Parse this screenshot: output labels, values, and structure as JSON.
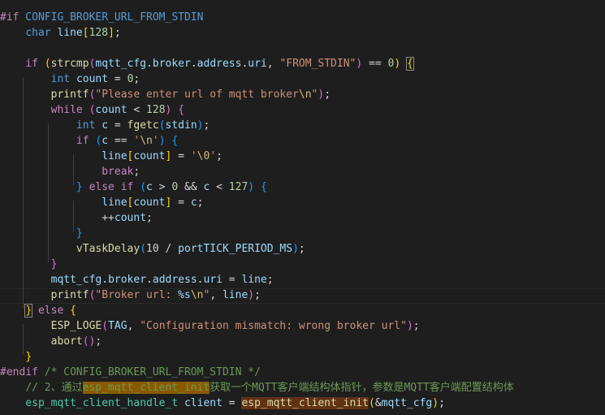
{
  "editor": {
    "lines": [
      {
        "tokens": [
          {
            "t": "#if",
            "c": "pp"
          },
          {
            "t": " CONFIG_BROKER_URL_FROM_STDIN",
            "c": "macro"
          }
        ]
      },
      {
        "tokens": [
          {
            "t": "    "
          },
          {
            "t": "char",
            "c": "kw"
          },
          {
            "t": " "
          },
          {
            "t": "line",
            "c": "var"
          },
          {
            "t": "[",
            "c": "br1"
          },
          {
            "t": "128",
            "c": "num"
          },
          {
            "t": "]",
            "c": "br1"
          },
          {
            "t": ";"
          }
        ]
      },
      {
        "tokens": []
      },
      {
        "tokens": [
          {
            "t": "    "
          },
          {
            "t": "if",
            "c": "ctrl"
          },
          {
            "t": " "
          },
          {
            "t": "(",
            "c": "br1"
          },
          {
            "t": "strcmp",
            "c": "fn"
          },
          {
            "t": "(",
            "c": "br2"
          },
          {
            "t": "mqtt_cfg",
            "c": "var"
          },
          {
            "t": "."
          },
          {
            "t": "broker",
            "c": "var"
          },
          {
            "t": "."
          },
          {
            "t": "address",
            "c": "var"
          },
          {
            "t": "."
          },
          {
            "t": "uri",
            "c": "var"
          },
          {
            "t": ", "
          },
          {
            "t": "\"FROM_STDIN\"",
            "c": "str"
          },
          {
            "t": ")",
            "c": "br2"
          },
          {
            "t": " == "
          },
          {
            "t": "0",
            "c": "num"
          },
          {
            "t": ")",
            "c": "br1"
          },
          {
            "t": " "
          },
          {
            "t": "{",
            "c": "br1 box"
          }
        ]
      },
      {
        "tokens": [
          {
            "t": "        "
          },
          {
            "t": "int",
            "c": "kw"
          },
          {
            "t": " "
          },
          {
            "t": "count",
            "c": "var"
          },
          {
            "t": " = "
          },
          {
            "t": "0",
            "c": "num"
          },
          {
            "t": ";"
          }
        ]
      },
      {
        "tokens": [
          {
            "t": "        "
          },
          {
            "t": "printf",
            "c": "fn"
          },
          {
            "t": "(",
            "c": "br2"
          },
          {
            "t": "\"Please enter url of mqtt broker",
            "c": "str"
          },
          {
            "t": "\\n",
            "c": "esc"
          },
          {
            "t": "\"",
            "c": "str"
          },
          {
            "t": ")",
            "c": "br2"
          },
          {
            "t": ";"
          }
        ]
      },
      {
        "tokens": [
          {
            "t": "        "
          },
          {
            "t": "while",
            "c": "ctrl"
          },
          {
            "t": " "
          },
          {
            "t": "(",
            "c": "br2"
          },
          {
            "t": "count",
            "c": "var"
          },
          {
            "t": " < "
          },
          {
            "t": "128",
            "c": "num"
          },
          {
            "t": ")",
            "c": "br2"
          },
          {
            "t": " "
          },
          {
            "t": "{",
            "c": "br2"
          }
        ]
      },
      {
        "tokens": [
          {
            "t": "            "
          },
          {
            "t": "int",
            "c": "kw"
          },
          {
            "t": " "
          },
          {
            "t": "c",
            "c": "var"
          },
          {
            "t": " = "
          },
          {
            "t": "fgetc",
            "c": "fn"
          },
          {
            "t": "(",
            "c": "br3"
          },
          {
            "t": "stdin",
            "c": "var"
          },
          {
            "t": ")",
            "c": "br3"
          },
          {
            "t": ";"
          }
        ]
      },
      {
        "tokens": [
          {
            "t": "            "
          },
          {
            "t": "if",
            "c": "ctrl"
          },
          {
            "t": " "
          },
          {
            "t": "(",
            "c": "br3"
          },
          {
            "t": "c",
            "c": "var"
          },
          {
            "t": " == "
          },
          {
            "t": "'",
            "c": "str"
          },
          {
            "t": "\\n",
            "c": "esc"
          },
          {
            "t": "'",
            "c": "str"
          },
          {
            "t": ")",
            "c": "br3"
          },
          {
            "t": " "
          },
          {
            "t": "{",
            "c": "br3"
          }
        ]
      },
      {
        "tokens": [
          {
            "t": "                "
          },
          {
            "t": "line",
            "c": "var"
          },
          {
            "t": "[",
            "c": "br1"
          },
          {
            "t": "count",
            "c": "var"
          },
          {
            "t": "]",
            "c": "br1"
          },
          {
            "t": " = "
          },
          {
            "t": "'",
            "c": "str"
          },
          {
            "t": "\\0",
            "c": "esc"
          },
          {
            "t": "'",
            "c": "str"
          },
          {
            "t": ";"
          }
        ]
      },
      {
        "tokens": [
          {
            "t": "                "
          },
          {
            "t": "break",
            "c": "ctrl"
          },
          {
            "t": ";"
          }
        ]
      },
      {
        "tokens": [
          {
            "t": "            "
          },
          {
            "t": "}",
            "c": "br3"
          },
          {
            "t": " "
          },
          {
            "t": "else",
            "c": "ctrl"
          },
          {
            "t": " "
          },
          {
            "t": "if",
            "c": "ctrl"
          },
          {
            "t": " "
          },
          {
            "t": "(",
            "c": "br3"
          },
          {
            "t": "c",
            "c": "var"
          },
          {
            "t": " > "
          },
          {
            "t": "0",
            "c": "num"
          },
          {
            "t": " && "
          },
          {
            "t": "c",
            "c": "var"
          },
          {
            "t": " < "
          },
          {
            "t": "127",
            "c": "num"
          },
          {
            "t": ")",
            "c": "br3"
          },
          {
            "t": " "
          },
          {
            "t": "{",
            "c": "br3"
          }
        ]
      },
      {
        "tokens": [
          {
            "t": "                "
          },
          {
            "t": "line",
            "c": "var"
          },
          {
            "t": "[",
            "c": "br1"
          },
          {
            "t": "count",
            "c": "var"
          },
          {
            "t": "]",
            "c": "br1"
          },
          {
            "t": " = "
          },
          {
            "t": "c",
            "c": "var"
          },
          {
            "t": ";"
          }
        ]
      },
      {
        "tokens": [
          {
            "t": "                "
          },
          {
            "t": "++"
          },
          {
            "t": "count",
            "c": "var"
          },
          {
            "t": ";"
          }
        ]
      },
      {
        "tokens": [
          {
            "t": "            "
          },
          {
            "t": "}",
            "c": "br3"
          }
        ]
      },
      {
        "tokens": [
          {
            "t": "            "
          },
          {
            "t": "vTaskDelay",
            "c": "fn"
          },
          {
            "t": "(",
            "c": "br3"
          },
          {
            "t": "10"
          },
          {
            "t": " / "
          },
          {
            "t": "portTICK_PERIOD_MS",
            "c": "var"
          },
          {
            "t": ")",
            "c": "br3"
          },
          {
            "t": ";"
          }
        ]
      },
      {
        "tokens": [
          {
            "t": "        "
          },
          {
            "t": "}",
            "c": "br2"
          }
        ]
      },
      {
        "tokens": [
          {
            "t": "        "
          },
          {
            "t": "mqtt_cfg",
            "c": "var"
          },
          {
            "t": "."
          },
          {
            "t": "broker",
            "c": "var"
          },
          {
            "t": "."
          },
          {
            "t": "address",
            "c": "var"
          },
          {
            "t": "."
          },
          {
            "t": "uri",
            "c": "var"
          },
          {
            "t": " = "
          },
          {
            "t": "line",
            "c": "var"
          },
          {
            "t": ";"
          }
        ]
      },
      {
        "tokens": [
          {
            "t": "        "
          },
          {
            "t": "printf",
            "c": "fn"
          },
          {
            "t": "(",
            "c": "br2"
          },
          {
            "t": "\"Broker url: ",
            "c": "str"
          },
          {
            "t": "%s",
            "c": "fmt"
          },
          {
            "t": "\\n",
            "c": "esc"
          },
          {
            "t": "\"",
            "c": "str"
          },
          {
            "t": ", "
          },
          {
            "t": "line",
            "c": "var"
          },
          {
            "t": ")",
            "c": "br2"
          },
          {
            "t": ";"
          }
        ]
      },
      {
        "tokens": [
          {
            "t": "    "
          },
          {
            "t": "}",
            "c": "br1 box"
          },
          {
            "t": " "
          },
          {
            "t": "else",
            "c": "ctrl"
          },
          {
            "t": " "
          },
          {
            "t": "{",
            "c": "br1"
          }
        ]
      },
      {
        "tokens": [
          {
            "t": "        "
          },
          {
            "t": "ESP_LOGE",
            "c": "fn"
          },
          {
            "t": "(",
            "c": "br2"
          },
          {
            "t": "TAG",
            "c": "var"
          },
          {
            "t": ", "
          },
          {
            "t": "\"Configuration mismatch: wrong broker url\"",
            "c": "str"
          },
          {
            "t": ")",
            "c": "br2"
          },
          {
            "t": ";"
          }
        ]
      },
      {
        "tokens": [
          {
            "t": "        "
          },
          {
            "t": "abort",
            "c": "fn"
          },
          {
            "t": "(",
            "c": "br2"
          },
          {
            "t": ")",
            "c": "br2"
          },
          {
            "t": ";"
          }
        ]
      },
      {
        "tokens": [
          {
            "t": "    "
          },
          {
            "t": "}",
            "c": "br1"
          }
        ]
      },
      {
        "tokens": [
          {
            "t": "#endif",
            "c": "pp"
          },
          {
            "t": " /* CONFIG_BROKER_URL_FROM_STDIN */",
            "c": "comment"
          }
        ]
      },
      {
        "tokens": [
          {
            "t": "    "
          },
          {
            "t": "// 2、通过",
            "c": "comment"
          },
          {
            "t": "esp_mqtt_client_init",
            "c": "hl-cmt"
          },
          {
            "t": "获取一个MQTT客户端结构体指针，参数是MQTT客户端配置结构体",
            "c": "comment"
          }
        ]
      },
      {
        "tokens": [
          {
            "t": "    "
          },
          {
            "t": "esp_mqtt_client_handle_t",
            "c": "type"
          },
          {
            "t": " "
          },
          {
            "t": "client",
            "c": "var"
          },
          {
            "t": " = "
          },
          {
            "t": "esp_mqtt_client_init",
            "c": "fn hl"
          },
          {
            "t": "(",
            "c": "br1"
          },
          {
            "t": "&"
          },
          {
            "t": "mqtt_cfg",
            "c": "var"
          },
          {
            "t": ")",
            "c": "br1"
          },
          {
            "t": ";"
          }
        ]
      }
    ]
  }
}
